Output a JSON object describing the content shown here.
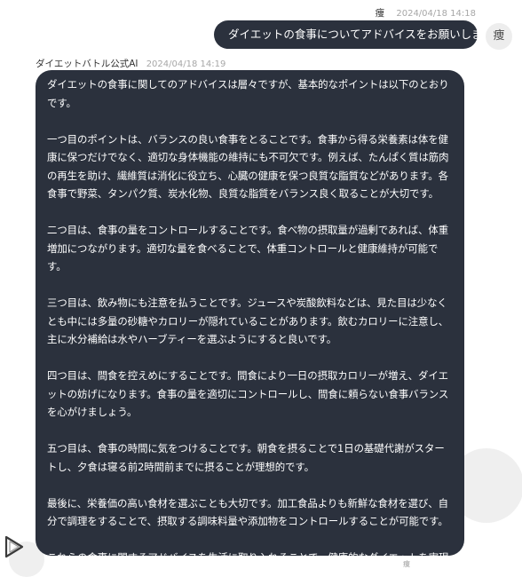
{
  "conversation": {
    "user": {
      "name": "痩",
      "timestamp": "2024/04/18 14:18",
      "message": "ダイエットの食事についてアドバイスをお願いします",
      "avatar_text": "痩"
    },
    "bot": {
      "name": "ダイエットバトル公式AI",
      "timestamp": "2024/04/18 14:19",
      "paragraphs": [
        "ダイエットの食事に関してのアドバイスは層々ですが、基本的なポイントは以下のとおりです。",
        "一つ目のポイントは、バランスの良い食事をとることです。食事から得る栄養素は体を健康に保つだけでなく、適切な身体機能の維持にも不可欠です。例えば、たんぱく質は筋肉の再生を助け、繊維質は消化に役立ち、心臓の健康を保つ良質な脂質などがあります。各食事で野菜、タンパク質、炭水化物、良質な脂質をバランス良く取ることが大切です。",
        "二つ目は、食事の量をコントロールすることです。食べ物の摂取量が過剰であれば、体重増加につながります。適切な量を食べることで、体重コントロールと健康維持が可能です。",
        "三つ目は、飲み物にも注意を払うことです。ジュースや炭酸飲料などは、見た目は少なくとも中には多量の砂糖やカロリーが隠れていることがあります。飲むカロリーに注意し、主に水分補給は水やハーブティーを選ぶようにすると良いです。",
        "四つ目は、間食を控えめにすることです。間食により一日の摂取カロリーが増え、ダイエットの妨げになります。食事の量を適切にコントロールし、間食に頼らない食事バランスを心がけましょう。",
        "五つ目は、食事の時間に気をつけることです。朝食を摂ることで1日の基礎代謝がスタートし、夕食は寝る前2時間前までに摂ることが理想的です。",
        "最後に、栄養価の高い食材を選ぶことも大切です。加工食品よりも新鮮な食材を選び、自分で調理をすることで、摂取する調味料量や添加物をコントロールすることが可能です。",
        "これらの食事に関するアドバイスを生活に取り入れることで、健康的なダイエットを実現することが可能です。"
      ]
    }
  },
  "bottom": {
    "tail_text": "痩"
  }
}
